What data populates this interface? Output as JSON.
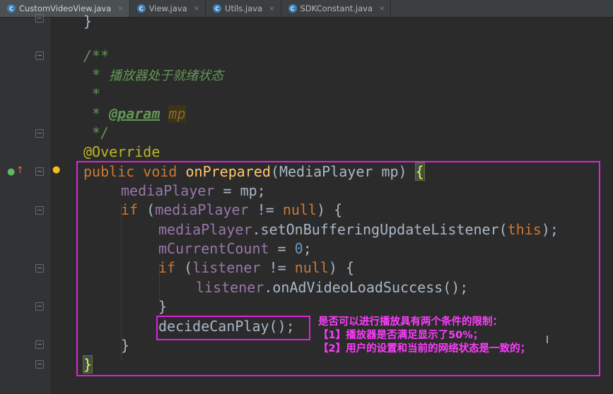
{
  "tabs": [
    {
      "label": "CustomVideoView.java",
      "active": true
    },
    {
      "label": "View.java",
      "active": false
    },
    {
      "label": "Utils.java",
      "active": false
    },
    {
      "label": "SDKConstant.java",
      "active": false
    }
  ],
  "tab_icon_letter": "C",
  "tab_close_glyph": "×",
  "code": {
    "l0": "}",
    "l1": "/**",
    "l2_star": " * ",
    "l2_text": "播放器处于就绪状态",
    "l3": " *",
    "l4_star": " * ",
    "l4_tag": "@param",
    "l4_sp": " ",
    "l4_name": "mp",
    "l5": " */",
    "l6": "@Override",
    "l7_kw1": "public",
    "l7_kw2": "void",
    "l7_fn": "onPrepared",
    "l7_params": "(MediaPlayer mp) ",
    "l7_brace": "{",
    "l8_field": "mediaPlayer",
    "l8_rest": " = mp;",
    "l9_kw": "if",
    "l9_open": " (",
    "l9_field": "mediaPlayer",
    "l9_op": " != ",
    "l9_null": "null",
    "l9_close": ") {",
    "l10_field": "mediaPlayer",
    "l10_call": ".setOnBufferingUpdateListener(",
    "l10_this": "this",
    "l10_end": ");",
    "l11_field": "mCurrentCount",
    "l11_op": " = ",
    "l11_num": "0",
    "l11_end": ";",
    "l12_kw": "if",
    "l12_open": " (",
    "l12_field": "listener",
    "l12_op": " != ",
    "l12_null": "null",
    "l12_close": ") {",
    "l13_field": "listener",
    "l13_call": ".onAdVideoLoadSuccess();",
    "l14": "}",
    "l15": "decideCanPlay();",
    "l16": "}",
    "l17": "}"
  },
  "annotation": {
    "line1": "是否可以进行播放具有两个条件的限制：",
    "line2": "【1】播放器是否满足显示了50%；",
    "line3": "【2】用户的设置和当前的网络状态是一致的；"
  },
  "colors": {
    "highlight_box": "#e020e0",
    "annotation_text": "#ff3cff"
  }
}
